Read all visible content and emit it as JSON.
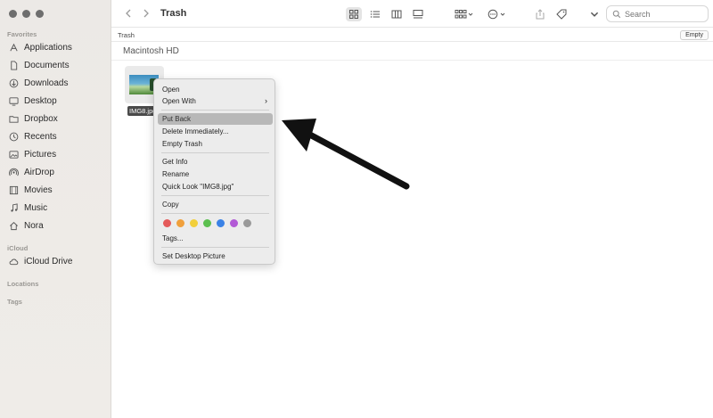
{
  "window": {
    "title": "Trash"
  },
  "sidebar": {
    "sections": {
      "favorites": "Favorites",
      "icloud": "iCloud",
      "locations": "Locations",
      "tags": "Tags"
    },
    "favorites": [
      {
        "label": "Applications",
        "icon": "applications-icon"
      },
      {
        "label": "Documents",
        "icon": "document-icon"
      },
      {
        "label": "Downloads",
        "icon": "download-icon"
      },
      {
        "label": "Desktop",
        "icon": "desktop-icon"
      },
      {
        "label": "Dropbox",
        "icon": "folder-icon"
      },
      {
        "label": "Recents",
        "icon": "clock-icon"
      },
      {
        "label": "Pictures",
        "icon": "photo-icon"
      },
      {
        "label": "AirDrop",
        "icon": "airdrop-icon"
      },
      {
        "label": "Movies",
        "icon": "film-icon"
      },
      {
        "label": "Music",
        "icon": "music-note-icon"
      },
      {
        "label": "Nora",
        "icon": "home-icon"
      }
    ],
    "icloud_items": [
      {
        "label": "iCloud Drive",
        "icon": "cloud-icon"
      }
    ]
  },
  "toolbar": {
    "search_placeholder": "Search"
  },
  "pathbar": {
    "label": "Trash",
    "empty_button": "Empty"
  },
  "volume": "Macintosh HD",
  "file": {
    "name": "IMG8.jpg"
  },
  "context_menu": {
    "items": {
      "open": "Open",
      "open_with": "Open With",
      "put_back": "Put Back",
      "delete_immediately": "Delete Immediately...",
      "empty_trash": "Empty Trash",
      "get_info": "Get Info",
      "rename": "Rename",
      "quick_look": "Quick Look \"IMG8.jpg\"",
      "copy": "Copy",
      "tags": "Tags...",
      "set_desktop_picture": "Set Desktop Picture"
    },
    "highlighted": "Put Back",
    "tag_colors": [
      "#e45a5a",
      "#f0a03c",
      "#f2cf3b",
      "#5bbf4f",
      "#3b82e6",
      "#b25ad6",
      "#9a9a9a"
    ]
  }
}
